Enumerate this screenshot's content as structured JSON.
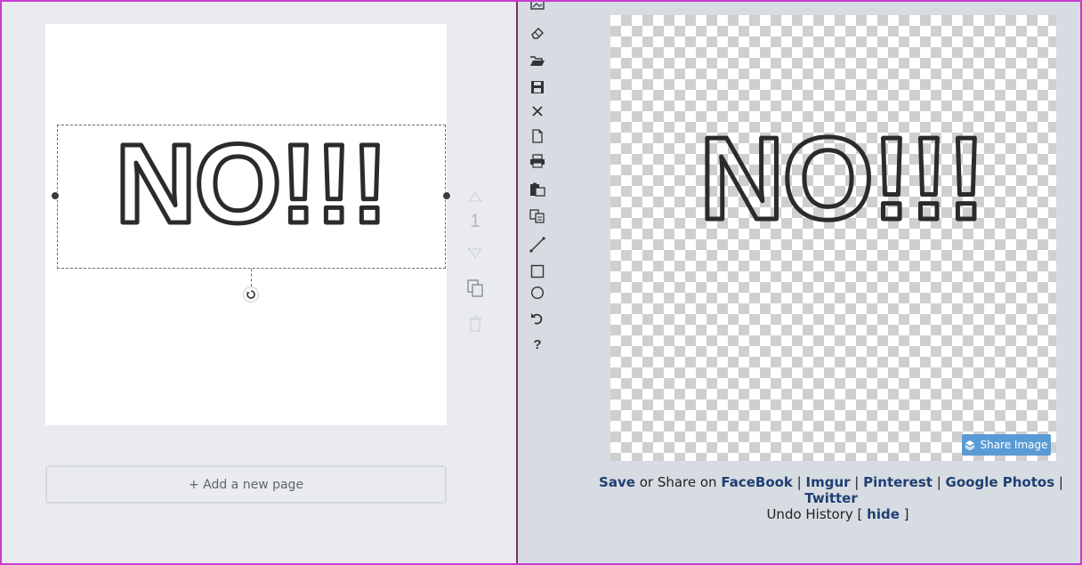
{
  "left": {
    "page_text": "NO!!!",
    "page_number": "1",
    "add_page_label": "+ Add a new page"
  },
  "right": {
    "canvas_text": "NO!!!",
    "share_image_label": "Share Image",
    "share_line": {
      "save": "Save",
      "mid": " or Share on ",
      "facebook": "FaceBook",
      "sep1": " | ",
      "imgur": "Imgur",
      "sep2": " | ",
      "pinterest": "Pinterest",
      "sep3": " | ",
      "google_photos": "Google Photos",
      "sep4": " | ",
      "twitter": "Twitter"
    },
    "undo": {
      "label": "Undo History",
      "open": " [ ",
      "hide": "hide",
      "close": " ]"
    },
    "tools": [
      "image-icon",
      "eraser-icon",
      "open-folder-icon",
      "save-icon",
      "close-icon",
      "new-file-icon",
      "print-icon",
      "paste-icon",
      "copy-icon",
      "line-icon",
      "rectangle-icon",
      "circle-icon",
      "undo-icon",
      "help-icon"
    ]
  }
}
